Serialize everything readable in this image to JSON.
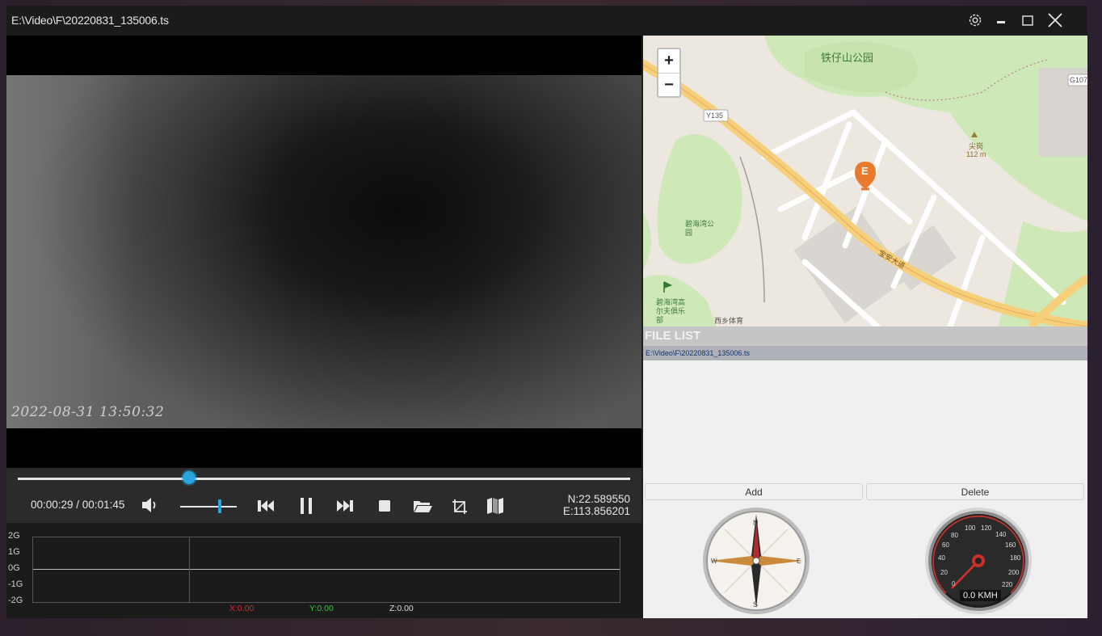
{
  "window": {
    "title": "E:\\Video\\F\\20220831_135006.ts"
  },
  "video": {
    "osd_timestamp": "2022-08-31 13:50:32"
  },
  "controls": {
    "time": "00:00:29 / 00:01:45",
    "seek_progress": 0.28,
    "volume": 0.7,
    "latitude": "N:22.589550",
    "longitude": "E:113.856201",
    "accent_color": "#28a4de"
  },
  "graph": {
    "y_labels": [
      "2G",
      "1G",
      "0G",
      "-1G",
      "-2G"
    ],
    "x": "X:0.00",
    "y": "Y:0.00",
    "z": "Z:0.00",
    "x_color": "#d42a2a",
    "y_color": "#2cc72c",
    "z_color": "#d8d8d8"
  },
  "map": {
    "zoom_in": "+",
    "zoom_out": "−",
    "marker_label": "E",
    "labels": {
      "park": "铁仔山公园",
      "road_badge": "Y135",
      "highway": "G107",
      "peak_name": "尖岗",
      "peak_elev": "112 m",
      "park2": "碧海湾公园",
      "golf": "碧海湾高尔夫俱乐部",
      "road_main": "宝安大道",
      "road2": "西乡体育"
    }
  },
  "file_list": {
    "header": "FILE LIST",
    "items": [
      "E:\\Video\\F\\20220831_135006.ts"
    ]
  },
  "buttons": {
    "add": "Add",
    "delete": "Delete"
  },
  "instruments": {
    "compass_labels": [
      "N",
      "E",
      "S",
      "W"
    ],
    "speed_ticks": [
      "0",
      "20",
      "40",
      "60",
      "80",
      "100",
      "120",
      "140",
      "160",
      "180",
      "200",
      "220"
    ],
    "speed_text": "0.0 KMH"
  }
}
